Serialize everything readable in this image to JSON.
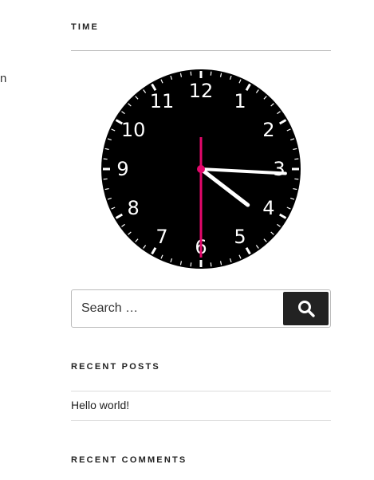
{
  "sidebar_edge_text": "n",
  "time_widget": {
    "title": "TIME",
    "clock": {
      "numbers": [
        "12",
        "1",
        "2",
        "3",
        "4",
        "5",
        "6",
        "7",
        "8",
        "9",
        "10",
        "11"
      ],
      "hours": 4,
      "minutes": 15,
      "seconds": 30,
      "face_color": "#000000",
      "hand_color": "#ffffff",
      "second_hand_color": "#e4086c"
    }
  },
  "search": {
    "placeholder": "Search …",
    "button_icon": "search-icon"
  },
  "recent_posts": {
    "title": "RECENT POSTS",
    "items": [
      "Hello world!"
    ]
  },
  "recent_comments": {
    "title": "RECENT COMMENTS"
  }
}
